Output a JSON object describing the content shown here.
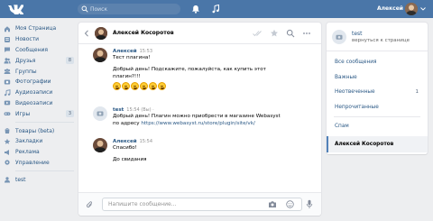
{
  "app": {
    "search_placeholder": "Поиск",
    "user_name": "Алексей",
    "icons": {
      "logo": "vk-logo",
      "search": "search-icon",
      "bell": "bell-icon",
      "music": "music-note-icon"
    },
    "accent_color": "#4a76a8"
  },
  "sidebar": {
    "items": [
      {
        "label": "Моя Страница",
        "icon": "home-icon",
        "count": ""
      },
      {
        "label": "Новости",
        "icon": "news-icon",
        "count": ""
      },
      {
        "label": "Сообщения",
        "icon": "messages-icon",
        "count": ""
      },
      {
        "label": "Друзья",
        "icon": "friends-icon",
        "count": "8"
      },
      {
        "label": "Группы",
        "icon": "groups-icon",
        "count": ""
      },
      {
        "label": "Фотографии",
        "icon": "photo-icon",
        "count": ""
      },
      {
        "label": "Аудиозаписи",
        "icon": "audio-icon",
        "count": ""
      },
      {
        "label": "Видеозаписи",
        "icon": "video-icon",
        "count": ""
      },
      {
        "label": "Игры",
        "icon": "games-icon",
        "count": "3"
      }
    ],
    "items2": [
      {
        "label": "Товары (beta)",
        "icon": "goods-icon"
      },
      {
        "label": "Закладки",
        "icon": "bookmark-icon"
      },
      {
        "label": "Реклама",
        "icon": "ads-icon"
      },
      {
        "label": "Управление",
        "icon": "settings-icon"
      }
    ],
    "items3": [
      {
        "label": "test",
        "icon": "user-icon"
      }
    ]
  },
  "chat": {
    "peer_name": "Алексей Косоротов",
    "messages": [
      {
        "author": "Алексей",
        "time": "15:53",
        "lines": [
          "Тест плагина!",
          "",
          "Добрый день! Подскажите, пожалуйста, как купить этот",
          "плагин?!!!"
        ],
        "emoji_count": 6
      },
      {
        "author": "test",
        "time": "15:54 (Вы) ·",
        "lines": [
          "Добрый день! Плагин можно приобрести в магазине Webasyst",
          "по адресу"
        ],
        "link": "https://www.webasyst.ru/store/plugin/site/vk/"
      },
      {
        "author": "Алексей",
        "time": "15:54",
        "lines": [
          "Спасибо!",
          "",
          "До свидания"
        ]
      }
    ],
    "compose_placeholder": "Напишите сообщение..."
  },
  "right_panel": {
    "user_name": "test",
    "user_sub": "вернуться к странице",
    "items": [
      {
        "label": "Все сообщения",
        "count": ""
      },
      {
        "label": "Важные",
        "count": ""
      },
      {
        "label": "Неотвеченные",
        "count": "1"
      },
      {
        "label": "Непрочитанные",
        "count": ""
      }
    ],
    "spam_label": "Спам",
    "active_dialog": "Алексей Косоротов"
  }
}
